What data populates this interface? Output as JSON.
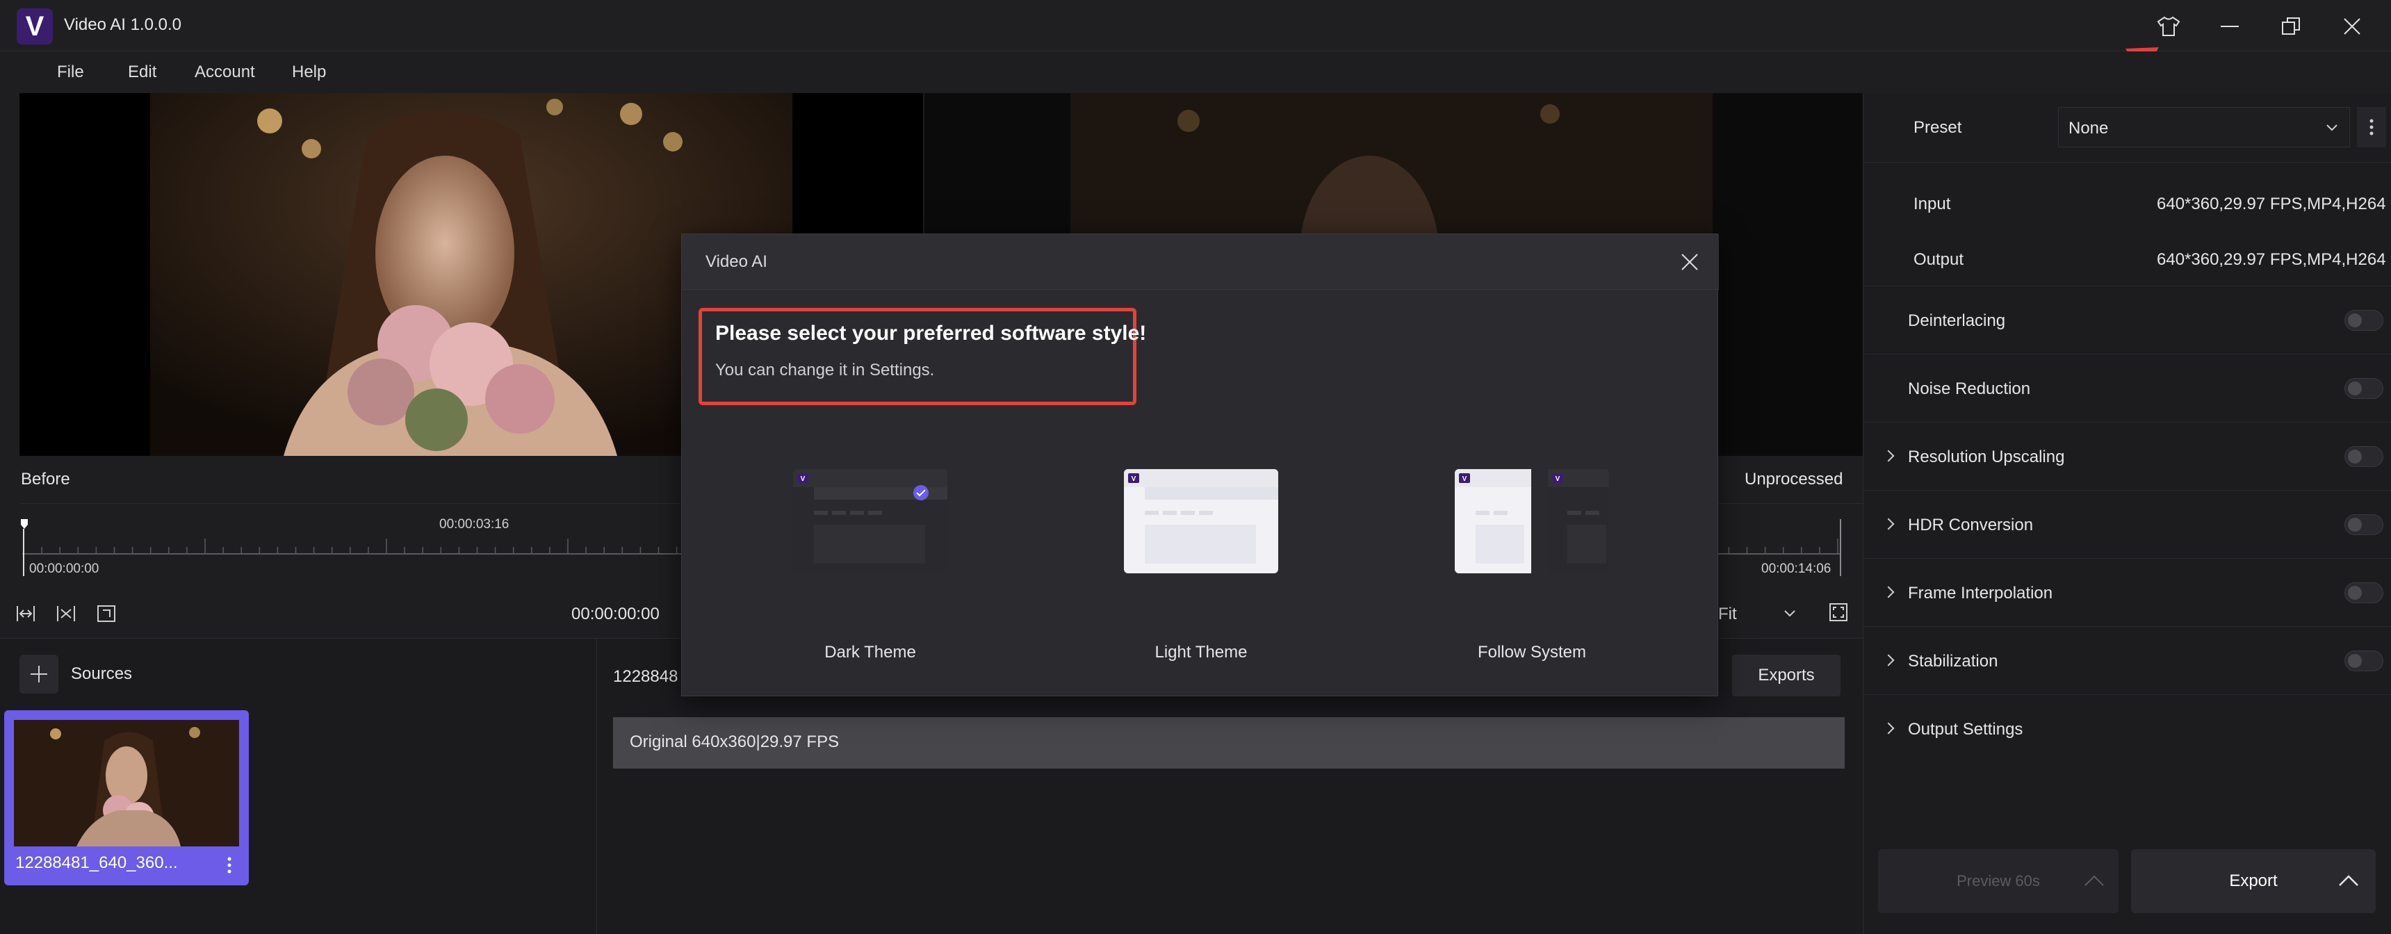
{
  "app": {
    "title": "Video AI 1.0.0.0",
    "logo_letter": "V"
  },
  "menu": [
    "File",
    "Edit",
    "Account",
    "Help"
  ],
  "preview": {
    "before_label": "Before",
    "after_label": "Unprocessed"
  },
  "timeline": {
    "start_time": "00:00:00:00",
    "mid_time": "00:00:03:16",
    "end_time": "00:00:14:06",
    "current_time": "00:00:00:00",
    "zoom": "Fit"
  },
  "sources": {
    "title": "Sources",
    "item_name": "12288481_640_360..."
  },
  "tasks": {
    "file_prefix": "1228848",
    "exports_label": "Exports",
    "original_info": "Original 640x360|29.97 FPS"
  },
  "settings": {
    "preset_label": "Preset",
    "preset_value": "None",
    "input_label": "Input",
    "input_value": "640*360,29.97 FPS,MP4,H264",
    "output_label": "Output",
    "output_value": "640*360,29.97 FPS,MP4,H264",
    "options": [
      "Deinterlacing",
      "Noise Reduction",
      "Resolution Upscaling",
      "HDR Conversion",
      "Frame Interpolation",
      "Stabilization",
      "Output Settings"
    ]
  },
  "buttons": {
    "preview": "Preview 60s",
    "export": "Export"
  },
  "dialog": {
    "title": "Video AI",
    "heading": "Please select your preferred software style!",
    "subtext": "You can change it in Settings.",
    "themes": [
      {
        "label": "Dark Theme",
        "selected": true
      },
      {
        "label": "Light Theme",
        "selected": false
      },
      {
        "label": "Follow System",
        "selected": false
      }
    ]
  },
  "colors": {
    "accent": "#6c5ce7",
    "highlight": "#e5413b",
    "brand": "#3b1d6e"
  }
}
